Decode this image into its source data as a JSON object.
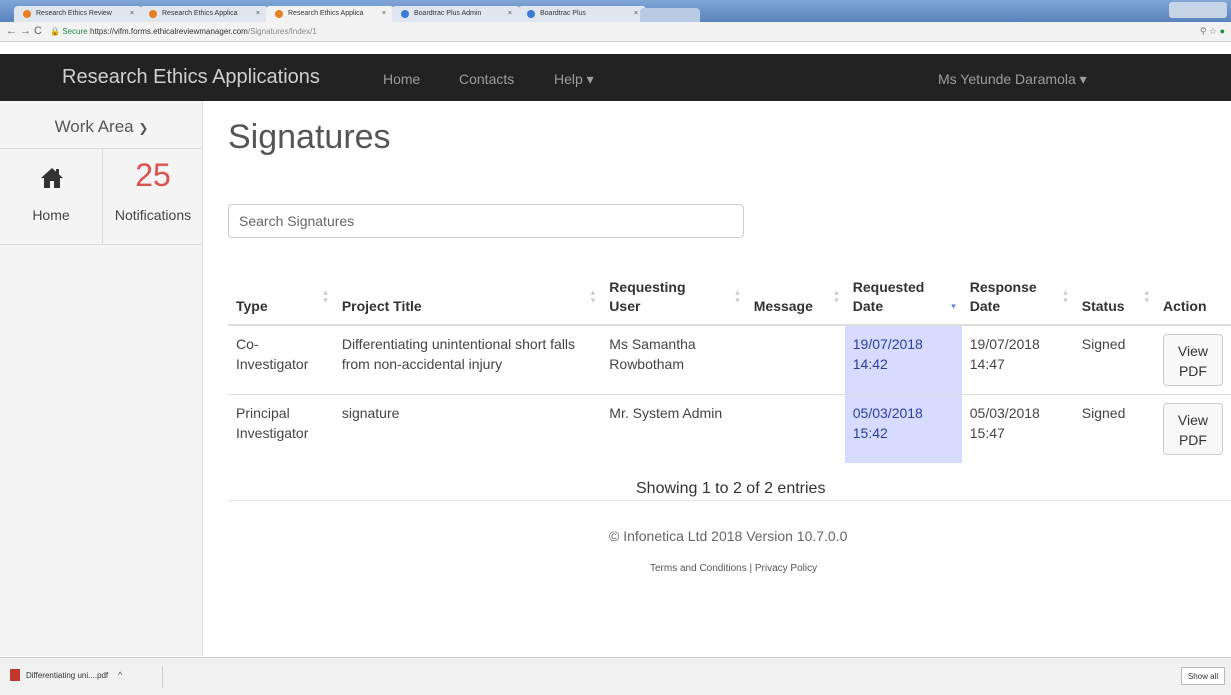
{
  "browser": {
    "tabs": [
      {
        "label": "Research Ethics Review",
        "active": false
      },
      {
        "label": "Research Ethics Applica",
        "active": false
      },
      {
        "label": "Research Ethics Applica",
        "active": true
      },
      {
        "label": "Boardtrac Plus Admin",
        "active": false
      },
      {
        "label": "Boardtrac Plus",
        "active": false
      }
    ],
    "secure_label": "Secure",
    "url_host": "https://vifm.forms.ethicalreviewmanager.com",
    "url_path": "/Signatures/Index/1"
  },
  "navbar": {
    "brand": "Research Ethics Applications",
    "links": [
      "Home",
      "Contacts",
      "Help ▾"
    ],
    "user": "Ms Yetunde Daramola ▾"
  },
  "sidebar": {
    "work_area": "Work Area",
    "home_label": "Home",
    "notifications_count": "25",
    "notifications_label": "Notifications"
  },
  "main": {
    "title": "Signatures",
    "search_placeholder": "Search Signatures",
    "columns": [
      "Type",
      "Project Title",
      "Requesting User",
      "Message",
      "Requested Date",
      "Response Date",
      "Status",
      "Action"
    ],
    "rows": [
      {
        "type": "Co-Investigator",
        "project_title": "Differentiating unintentional short falls from non-accidental injury",
        "requesting_user": "Ms Samantha Rowbotham",
        "message": "",
        "requested_date": "19/07/2018 14:42",
        "response_date": "19/07/2018 14:47",
        "status": "Signed",
        "action": "View PDF"
      },
      {
        "type": "Principal Investigator",
        "project_title": "signature",
        "requesting_user": "Mr. System Admin",
        "message": "",
        "requested_date": "05/03/2018 15:42",
        "response_date": "05/03/2018 15:47",
        "status": "Signed",
        "action": "View PDF"
      }
    ],
    "showing": "Showing 1 to 2 of 2 entries",
    "footer": "© Infonetica Ltd 2018 Version 10.7.0.0",
    "terms": "Terms and Conditions",
    "privacy": "Privacy Policy"
  },
  "downloads": {
    "file": "Differentiating uni....pdf",
    "show_all": "Show all"
  }
}
